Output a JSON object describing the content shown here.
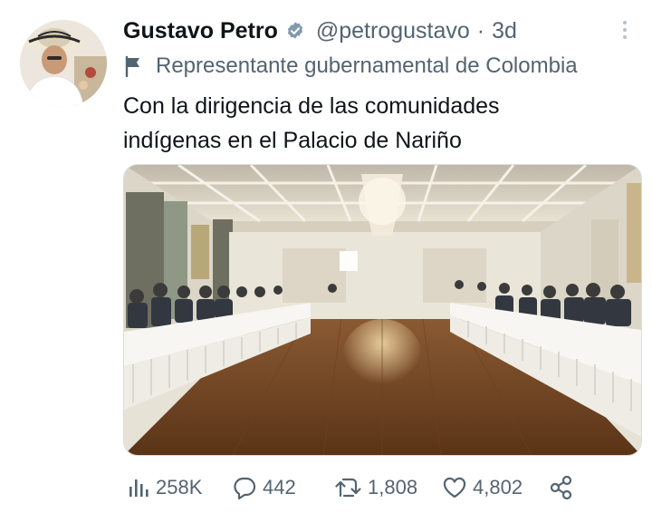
{
  "author": {
    "name": "Gustavo Petro",
    "handle": "@petrogustavo",
    "separator": "·",
    "time": "3d",
    "label": "Representante gubernamental de Colombia"
  },
  "tweet": {
    "lines": [
      "Con la dirigencia de las comunidades",
      "indígenas en el Palacio de Nariño"
    ]
  },
  "metrics": {
    "views": "258K",
    "replies": "442",
    "retweets": "1,808",
    "likes": "4,802"
  },
  "icons": {
    "verified": "verified-badge-icon",
    "label": "flag-icon",
    "more": "more-options-icon",
    "views": "views-bar-chart-icon",
    "reply": "reply-bubble-icon",
    "retweet": "retweet-icon",
    "like": "heart-icon",
    "share": "share-icon"
  },
  "colors": {
    "text": "#0f1419",
    "secondary": "#536471",
    "verified_badge": "#829aab"
  }
}
